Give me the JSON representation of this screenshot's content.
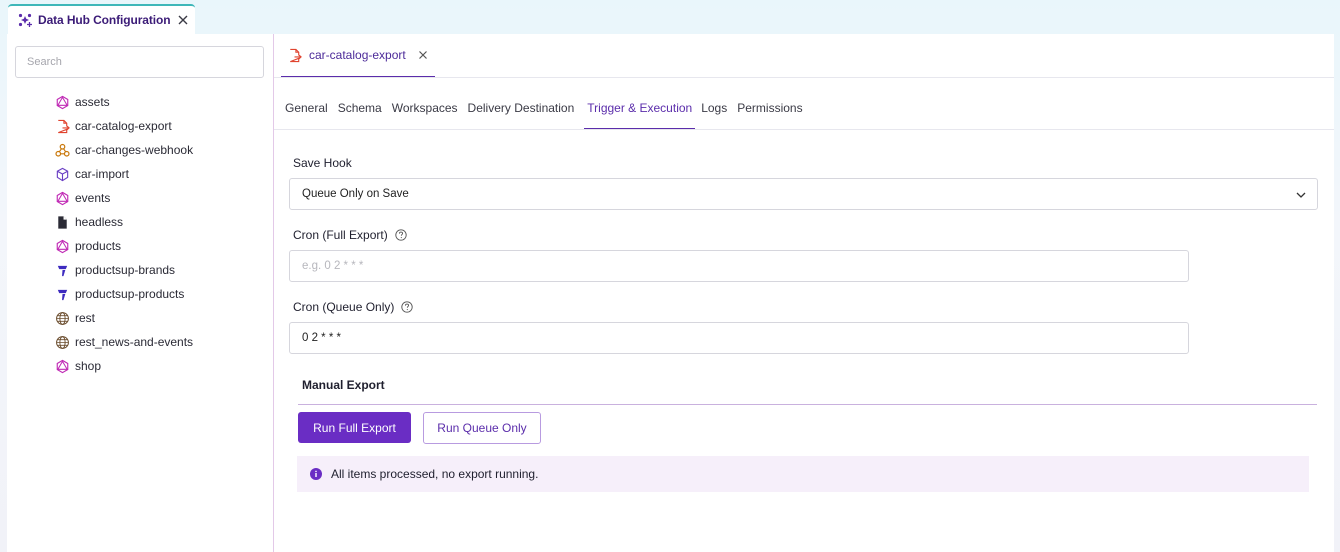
{
  "app_tab": {
    "title": "Data Hub Configuration"
  },
  "sidebar": {
    "search_placeholder": "Search",
    "items": [
      {
        "label": "assets",
        "icon": "graphql-icon"
      },
      {
        "label": "car-catalog-export",
        "icon": "file-export-icon"
      },
      {
        "label": "car-changes-webhook",
        "icon": "webhook-icon"
      },
      {
        "label": "car-import",
        "icon": "cube-import-icon"
      },
      {
        "label": "events",
        "icon": "graphql-icon"
      },
      {
        "label": "headless",
        "icon": "document-icon"
      },
      {
        "label": "products",
        "icon": "graphql-icon"
      },
      {
        "label": "productsup-brands",
        "icon": "productsup-icon"
      },
      {
        "label": "productsup-products",
        "icon": "productsup-icon"
      },
      {
        "label": "rest",
        "icon": "globe-icon"
      },
      {
        "label": "rest_news-and-events",
        "icon": "globe-icon"
      },
      {
        "label": "shop",
        "icon": "graphql-icon"
      }
    ]
  },
  "doc_tab": {
    "label": "car-catalog-export"
  },
  "subtabs": [
    "General",
    "Schema",
    "Workspaces",
    "Delivery Destination",
    "Trigger & Execution",
    "Logs",
    "Permissions"
  ],
  "active_subtab": "Trigger & Execution",
  "form": {
    "save_hook_label": "Save Hook",
    "save_hook_value": "Queue Only on Save",
    "cron_full_label": "Cron (Full Export)",
    "cron_full_placeholder": "e.g. 0 2 * * *",
    "cron_full_value": "",
    "cron_queue_label": "Cron (Queue Only)",
    "cron_queue_value": "0 2 * * *"
  },
  "manual_export": {
    "title": "Manual Export",
    "run_full_label": "Run Full Export",
    "run_queue_label": "Run Queue Only",
    "status_message": "All items processed, no export running."
  },
  "colors": {
    "accent": "#6a2dc4",
    "tab_accent": "#3fb7b9",
    "alert_bg": "#f6effa"
  }
}
